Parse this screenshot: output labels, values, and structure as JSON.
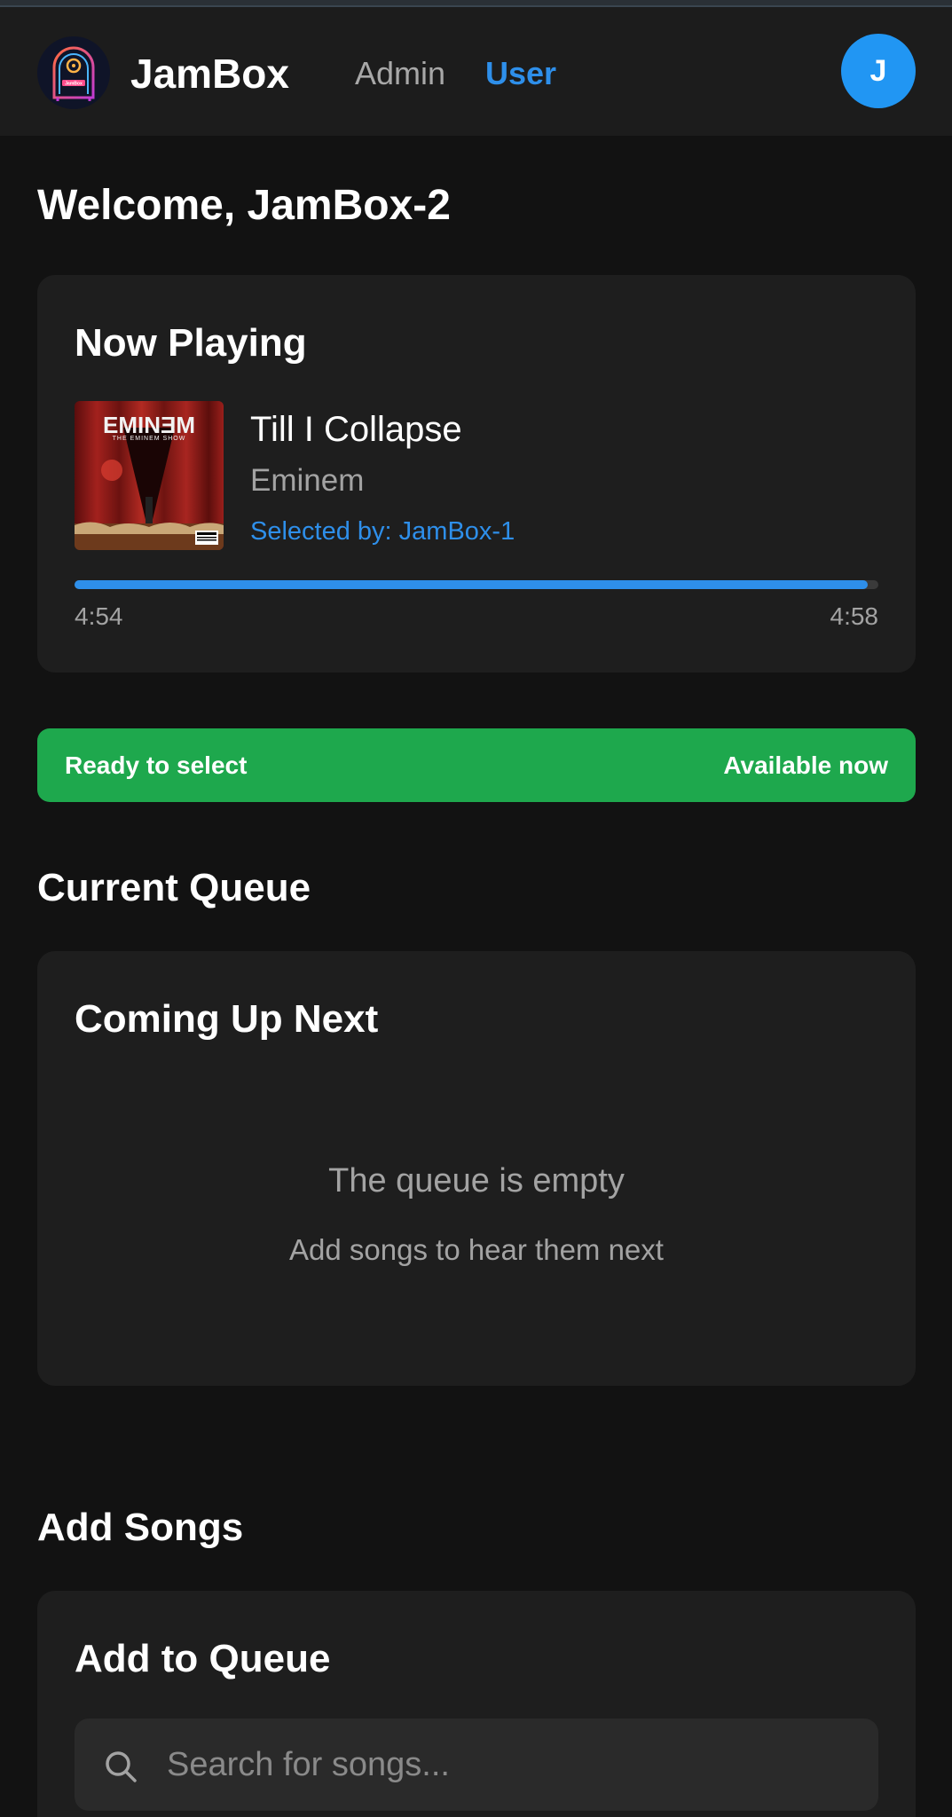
{
  "header": {
    "brand": "JamBox",
    "nav": {
      "admin": "Admin",
      "user": "User"
    },
    "avatar_initial": "J",
    "logo_text": "JamBox"
  },
  "welcome": "Welcome, JamBox-2",
  "now_playing": {
    "title": "Now Playing",
    "album_label": "EMINƎM",
    "album_sublabel": "THE EMINEM SHOW",
    "song": "Till I Collapse",
    "artist": "Eminem",
    "selected_by": "Selected by: JamBox-1",
    "current_time": "4:54",
    "total_time": "4:58",
    "progress": 0.987
  },
  "status": {
    "left": "Ready to select",
    "right": "Available now",
    "color": "#1ea84d"
  },
  "queue": {
    "section": "Current Queue",
    "card_title": "Coming Up Next",
    "empty_title": "The queue is empty",
    "empty_subtitle": "Add songs to hear them next"
  },
  "add_songs": {
    "section": "Add Songs",
    "card_title": "Add to Queue",
    "search_placeholder": "Search for songs..."
  },
  "colors": {
    "accent": "#2e8fea",
    "background": "#121212",
    "card": "#1e1e1e"
  }
}
